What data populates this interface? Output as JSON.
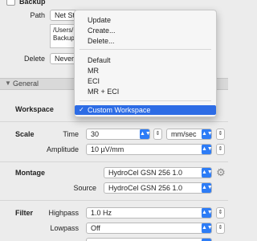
{
  "backup": {
    "checkbox_label": "Backup"
  },
  "path": {
    "label": "Path",
    "value": "Net Station Event Table",
    "list": [
      "/Users/...",
      "Backup..."
    ]
  },
  "delete": {
    "label": "Delete",
    "value": "Never"
  },
  "menu": {
    "group1": [
      "Update",
      "Create...",
      "Delete..."
    ],
    "group2": [
      "Default",
      "MR",
      "ECI",
      "MR + ECI"
    ],
    "selected_check": "✓",
    "selected": "Custom Workspace"
  },
  "section": {
    "title": "General",
    "toggle_icon": "disclosure-triangle"
  },
  "workspace": {
    "label": "Workspace"
  },
  "scale": {
    "label": "Scale",
    "time_label": "Time",
    "time_value": "30",
    "time_unit": "mm/sec",
    "amplitude_label": "Amplitude",
    "amplitude_value": "10 µV/mm"
  },
  "montage": {
    "label": "Montage",
    "value": "HydroCel GSN 256 1.0",
    "source_label": "Source",
    "source_value": "HydroCel GSN 256 1.0"
  },
  "filter": {
    "label": "Filter",
    "highpass_label": "Highpass",
    "highpass_value": "1.0 Hz",
    "lowpass_label": "Lowpass",
    "lowpass_value": "Off"
  },
  "icons": {
    "popup_chevron": "⌃⌄",
    "stepper": "⇕",
    "gear": "⚙"
  },
  "colors": {
    "accent": "#2d7cf6",
    "selection": "#2d6ce5",
    "background": "#ececec"
  }
}
